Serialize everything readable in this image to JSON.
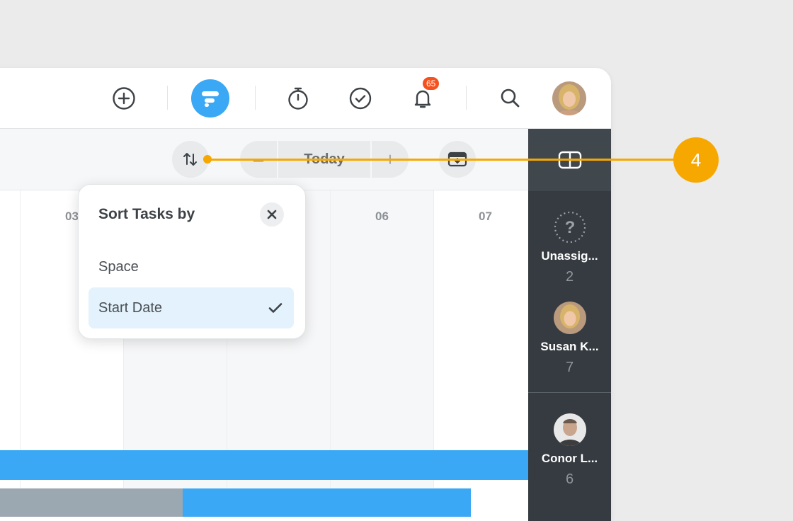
{
  "topbar": {
    "notification_count": "65",
    "icons": [
      "plus-circle-icon",
      "gantt-icon",
      "stopwatch-icon",
      "check-circle-icon",
      "bell-icon",
      "search-icon"
    ]
  },
  "toolbar": {
    "today_label": "Today",
    "minus_label": "–",
    "plus_label": "+"
  },
  "timeline": {
    "days": [
      "03",
      "",
      "",
      "06",
      "07"
    ]
  },
  "sort_popover": {
    "title": "Sort Tasks by",
    "options": [
      {
        "label": "Space",
        "selected": false
      },
      {
        "label": "Start Date",
        "selected": true
      }
    ]
  },
  "sidebar": {
    "people": [
      {
        "name": "Unassig...",
        "count": "2"
      },
      {
        "name": "Susan K...",
        "count": "7"
      },
      {
        "name": "Conor L...",
        "count": "6"
      }
    ]
  },
  "callout": {
    "number": "4"
  },
  "colors": {
    "accent_blue": "#3aa8f5",
    "callout_orange": "#f7a800",
    "badge_red": "#f4511e"
  }
}
